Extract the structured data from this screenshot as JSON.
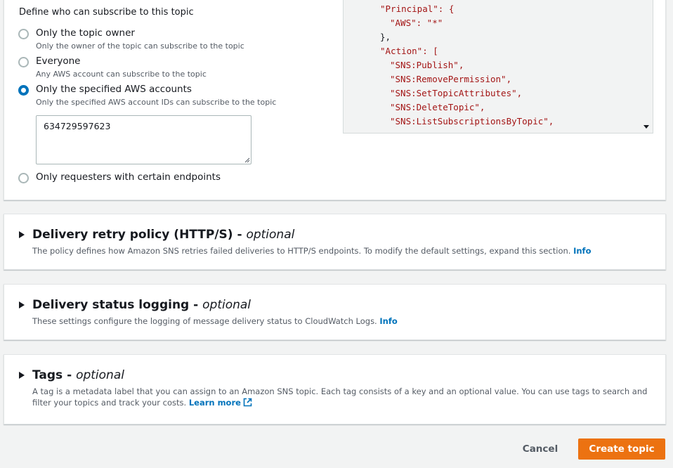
{
  "access_policy": {
    "define_label": "Define who can subscribe to this topic",
    "options": [
      {
        "title": "Only the topic owner",
        "description": "Only the owner of the topic can subscribe to the topic",
        "selected": false
      },
      {
        "title": "Everyone",
        "description": "Any AWS account can subscribe to the topic",
        "selected": false
      },
      {
        "title": "Only the specified AWS accounts",
        "description": "Only the specified AWS account IDs can subscribe to the topic",
        "selected": true
      },
      {
        "title": "Only requesters with certain endpoints",
        "selected": false
      }
    ],
    "accounts_value": "634729597623",
    "json_lines": [
      "\"Principal\": {",
      "\"AWS\": \"*\"",
      "},",
      "\"Action\": [",
      "\"SNS:Publish\",",
      "\"SNS:RemovePermission\",",
      "\"SNS:SetTopicAttributes\",",
      "\"SNS:DeleteTopic\",",
      "\"SNS:ListSubscriptionsByTopic\","
    ]
  },
  "sections": {
    "delivery_retry": {
      "title": "Delivery retry policy (HTTP/S) -",
      "optional": "optional",
      "description": "The policy defines how Amazon SNS retries failed deliveries to HTTP/S endpoints. To modify the default settings, expand this section.",
      "link": "Info"
    },
    "delivery_logging": {
      "title": "Delivery status logging -",
      "optional": "optional",
      "description": "These settings configure the logging of message delivery status to CloudWatch Logs.",
      "link": "Info"
    },
    "tags": {
      "title": "Tags -",
      "optional": "optional",
      "description": "A tag is a metadata label that you can assign to an Amazon SNS topic. Each tag consists of a key and an optional value. You can use tags to search and filter your topics and track your costs.",
      "link": "Learn more"
    }
  },
  "footer": {
    "cancel_label": "Cancel",
    "create_label": "Create topic"
  },
  "colors": {
    "primary_button": "#ec7211",
    "link": "#0073bb",
    "radio_selected": "#0073bb",
    "json_string": "#a31515"
  },
  "icons": {
    "expand": "caret-right-icon",
    "external_link": "external-link-icon",
    "dropdown": "caret-down-icon"
  }
}
